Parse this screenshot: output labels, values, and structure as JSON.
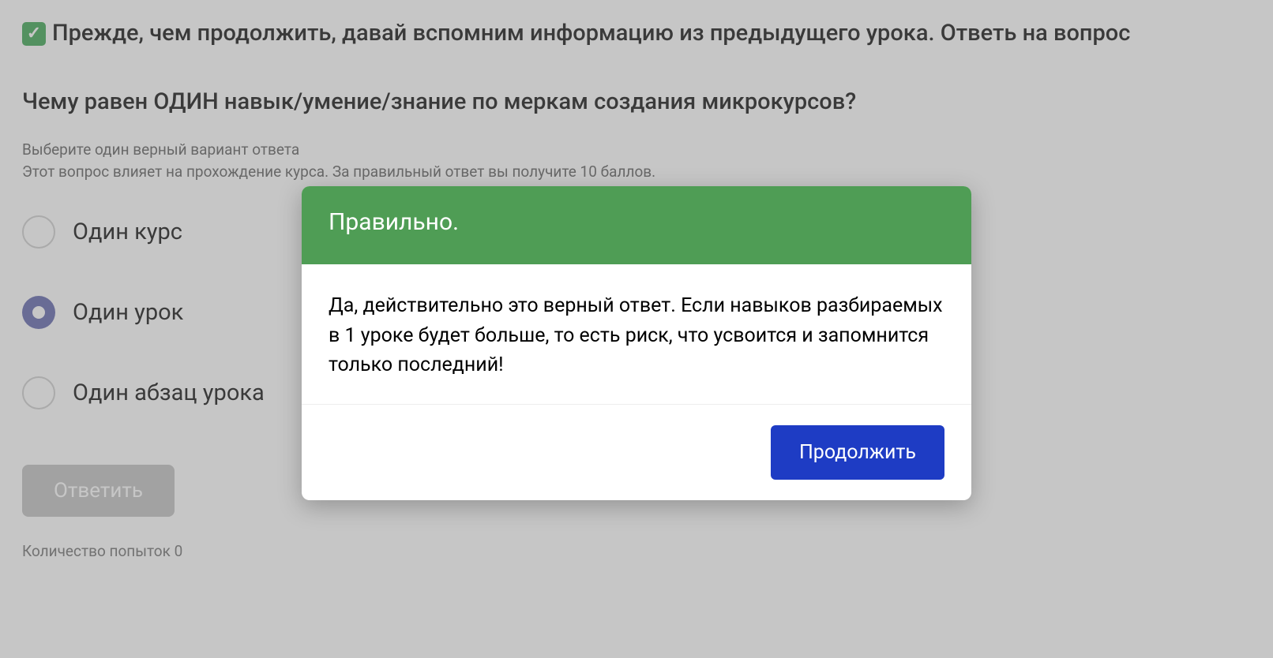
{
  "intro": "Прежде, чем продолжить, давай вспомним информацию из предыдущего урока. Ответь на вопрос",
  "question": "Чему равен ОДИН навык/умение/знание по меркам создания микрокурсов?",
  "instructions": {
    "line1": "Выберите один верный вариант ответа",
    "line2": "Этот вопрос влияет на прохождение курса. За правильный ответ вы получите 10 баллов."
  },
  "options": [
    {
      "label": "Один курс",
      "selected": false
    },
    {
      "label": "Один урок",
      "selected": true
    },
    {
      "label": "Один абзац урока",
      "selected": false
    }
  ],
  "answer_button": "Ответить",
  "attempts_label": "Количество попыток 0",
  "modal": {
    "title": "Правильно.",
    "body": "Да, действительно это верный ответ. Если навыков разбираемых в 1 уроке будет больше, то есть риск, что усвоится и запомнится только последний!",
    "continue": "Продолжить"
  }
}
